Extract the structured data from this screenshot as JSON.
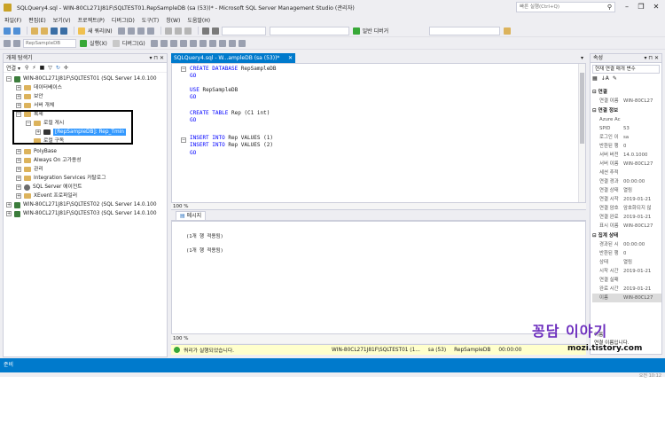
{
  "window": {
    "title": "SQLQuery4.sql - WIN-80CL271J81F\\SQLTEST01.RepSampleDB (sa (53))* - Microsoft SQL Server Management Studio (관리자)",
    "quick_launch_placeholder": "빠른 실행(Ctrl+Q)",
    "min": "–",
    "max": "❐",
    "close": "✕"
  },
  "menu": [
    "파일(F)",
    "편집(E)",
    "보기(V)",
    "프로젝트(P)",
    "디버그(D)",
    "도구(T)",
    "창(W)",
    "도움말(H)"
  ],
  "toolbar1": {
    "new_query": "새 쿼리(N)",
    "solution_config": "",
    "generic_debugger": "일반 디버거"
  },
  "toolbar2": {
    "database": "RepSampleDB",
    "execute": "실행(X)",
    "debug": "디버그(G)"
  },
  "object_explorer": {
    "header": "개체 탐색기",
    "connect": "연결 ▾",
    "tree": [
      "WIN-80CL271J81F\\SQLTEST01 (SQL Server 14.0.100",
      "데이터베이스",
      "보안",
      "서버 개체",
      "복제",
      "로컬 게시",
      "[RepSampleDB]: Rep_Tmin",
      "로컬 구독",
      "PolyBase",
      "Always On 고가용성",
      "관리",
      "Integration Services 카탈로그",
      "SQL Server 에이전트",
      "XEvent 프로파일러",
      "WIN-80CL271J81F\\SQLTEST02 (SQL Server 14.0.100",
      "WIN-80CL271J81F\\SQLTEST03 (SQL Server 14.0.100"
    ]
  },
  "editor": {
    "tab": "SQLQuery4.sql - W...ampleDB (sa (53))*",
    "lines": [
      [
        "CREATE DATABASE ",
        "RepSampleDB"
      ],
      [
        "GO",
        ""
      ],
      [
        "",
        ""
      ],
      [
        "USE ",
        "RepSampleDB"
      ],
      [
        "GO",
        ""
      ],
      [
        "",
        ""
      ],
      [
        "CREATE TABLE ",
        "Rep (C1 int)"
      ],
      [
        "GO",
        ""
      ],
      [
        "",
        ""
      ],
      [
        "INSERT INTO ",
        "Rep VALUES (1)"
      ],
      [
        "INSERT INTO ",
        "Rep VALUES (2)"
      ],
      [
        "GO",
        ""
      ]
    ],
    "zoom": "100 %"
  },
  "results": {
    "tab": "메시지",
    "messages": [
      "(1개 행 적용됨)",
      "(1개 행 적용됨)"
    ],
    "zoom": "100 %"
  },
  "query_status": {
    "message": "쿼리가 실행되었습니다.",
    "server": "WIN-80CL271J81F\\SQLTEST01 (1...",
    "user": "sa (53)",
    "db": "RepSampleDB",
    "time": "00:00:00"
  },
  "properties": {
    "header": "속성",
    "object": "현재 연결 매개 변수",
    "categories": {
      "connection": "연결",
      "connection_detail": "연결 정보",
      "aggregate": "집계 상태"
    },
    "rows": [
      [
        "연결 이름",
        "WIN-80CL27"
      ],
      [
        "Azure Ac",
        ""
      ],
      [
        "SPID",
        "53"
      ],
      [
        "로그인 이",
        "sa"
      ],
      [
        "반환된 행",
        "0"
      ],
      [
        "서버 버전",
        "14.0.1000"
      ],
      [
        "서버 이름",
        "WIN-80CL27"
      ],
      [
        "세션 추적",
        ""
      ],
      [
        "연결 경과",
        "00:00:00"
      ],
      [
        "연결 상태",
        "열림"
      ],
      [
        "연결 시작",
        "2019-01-21"
      ],
      [
        "연결 암호",
        "암호화되지 않"
      ],
      [
        "연결 완료",
        "2019-01-21"
      ],
      [
        "표시 이름",
        "WIN-80CL27"
      ],
      [
        "경과된 시",
        "00:00:00"
      ],
      [
        "반환된 행",
        "0"
      ],
      [
        "상태",
        "열림"
      ],
      [
        "시작 시간",
        "2019-01-21"
      ],
      [
        "연결 실패",
        ""
      ],
      [
        "완료 시간",
        "2019-01-21"
      ],
      [
        "이름",
        "WIN-80CL27"
      ]
    ],
    "desc_name": "이름",
    "desc_text": "연결 이름입니다."
  },
  "statusbar": {
    "text": "준비",
    "time": "오전 10:12"
  },
  "watermark": {
    "line1": "꽁담 이야기",
    "line2": "mozi.tistory.com"
  },
  "colors": {
    "accent": "#007acc",
    "keyword": "#0000ff",
    "selection": "#3399ff"
  }
}
